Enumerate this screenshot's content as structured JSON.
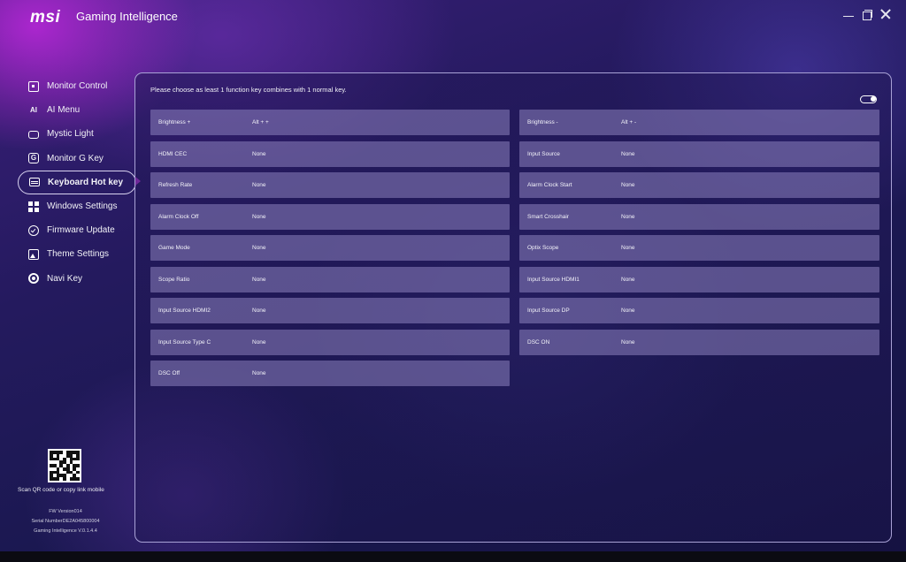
{
  "app": {
    "logo": "msi",
    "title": "Gaming Intelligence"
  },
  "window_controls": [
    "minimize-icon",
    "maximize-icon",
    "close-icon"
  ],
  "sidebar": {
    "items": [
      {
        "label": "Monitor Control",
        "icon": "monitor-icon"
      },
      {
        "label": "AI Menu",
        "icon": "ai-icon"
      },
      {
        "label": "Mystic Light",
        "icon": "mystic-light-icon"
      },
      {
        "label": "Monitor G Key",
        "icon": "g-key-icon"
      },
      {
        "label": "Keyboard Hot key",
        "icon": "keyboard-icon",
        "active": true
      },
      {
        "label": "Windows Settings",
        "icon": "windows-icon"
      },
      {
        "label": "Firmware Update",
        "icon": "firmware-icon"
      },
      {
        "label": "Theme Settings",
        "icon": "theme-icon"
      },
      {
        "label": "Navi Key",
        "icon": "navi-key-icon"
      }
    ],
    "qr_caption": "Scan QR code or copy link mobile",
    "fw_version": "FW Version014",
    "serial_number": "Serial NumberDE2A045800004",
    "app_version": "Gaming Intelligence V.0.1.4.4"
  },
  "main": {
    "instruction": "Please choose as least 1 function key combines with 1 normal key.",
    "toggle_on": true,
    "hotkeys_left": [
      {
        "function": "Brightness +",
        "key": "Alt + +"
      },
      {
        "function": "HDMI CEC",
        "key": "None"
      },
      {
        "function": "Refresh Rate",
        "key": "None"
      },
      {
        "function": "Alarm Clock Off",
        "key": "None"
      },
      {
        "function": "Game Mode",
        "key": "None"
      },
      {
        "function": "Scope Ratio",
        "key": "None"
      },
      {
        "function": "Input Source HDMI2",
        "key": "None"
      },
      {
        "function": "Input Source Type C",
        "key": "None"
      },
      {
        "function": "DSC Off",
        "key": "None"
      }
    ],
    "hotkeys_right": [
      {
        "function": "Brightness -",
        "key": "Alt + -"
      },
      {
        "function": "Input Source",
        "key": "None"
      },
      {
        "function": "Alarm Clock Start",
        "key": "None"
      },
      {
        "function": "Smart Crosshair",
        "key": "None"
      },
      {
        "function": "Optix Scope",
        "key": "None"
      },
      {
        "function": "Input Source HDMI1",
        "key": "None"
      },
      {
        "function": "Input Source DP",
        "key": "None"
      },
      {
        "function": "DSC ON",
        "key": "None"
      }
    ]
  }
}
